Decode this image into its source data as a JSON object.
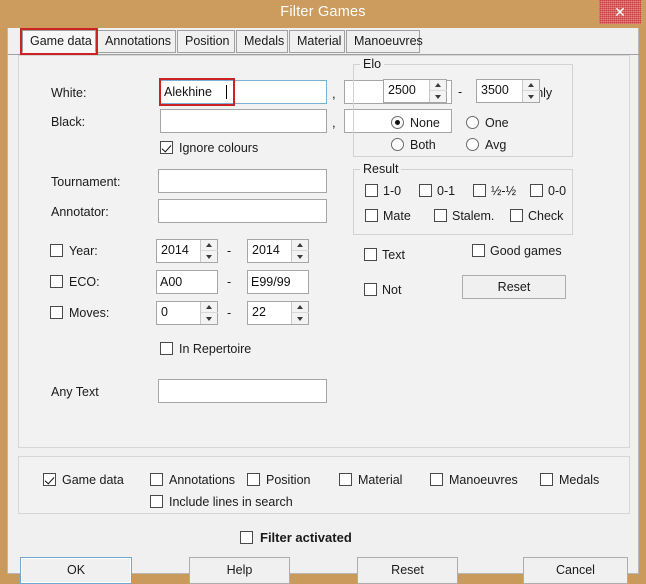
{
  "window": {
    "title": "Filter Games",
    "close_icon": "close-icon",
    "close_label": "✕",
    "titlebar_color": "#cc9b5e",
    "close_color": "#c9413c",
    "annotation_color": "#cc2222"
  },
  "tabs": [
    {
      "label": "Game data",
      "active": true
    },
    {
      "label": "Annotations",
      "active": false
    },
    {
      "label": "Position",
      "active": false
    },
    {
      "label": "Medals",
      "active": false
    },
    {
      "label": "Material",
      "active": false
    },
    {
      "label": "Manoeuvres",
      "active": false
    }
  ],
  "form": {
    "white_label": "White:",
    "white_value": "Alekhine",
    "white_first_value": "",
    "black_label": "Black:",
    "black_value": "",
    "black_first_value": "",
    "comma": ",",
    "ignore_colours_label": "Ignore colours",
    "ignore_colours_checked": true,
    "wins_only_label": "Wins only",
    "wins_only_checked": false,
    "tournament_label": "Tournament:",
    "tournament_value": "",
    "annotator_label": "Annotator:",
    "annotator_value": "",
    "year_label": "Year:",
    "year_checked": false,
    "year_from": "2014",
    "year_to": "2014",
    "eco_label": "ECO:",
    "eco_checked": false,
    "eco_from": "A00",
    "eco_to": "E99/99",
    "moves_label": "Moves:",
    "moves_checked": false,
    "moves_from": "0",
    "moves_to": "22",
    "in_repertoire_label": "In Repertoire",
    "in_repertoire_checked": false,
    "any_text_label": "Any Text",
    "any_text_value": "",
    "range_dash": "-"
  },
  "elo": {
    "title": "Elo",
    "from": "2500",
    "to": "3500",
    "dash": "-",
    "options": [
      {
        "label": "None",
        "selected": true
      },
      {
        "label": "One",
        "selected": false
      },
      {
        "label": "Both",
        "selected": false
      },
      {
        "label": "Avg",
        "selected": false
      }
    ]
  },
  "result": {
    "title": "Result",
    "items": [
      {
        "label": "1-0",
        "checked": false
      },
      {
        "label": "0-1",
        "checked": false
      },
      {
        "label": "½-½",
        "checked": false
      },
      {
        "label": "0-0",
        "checked": false
      },
      {
        "label": "Mate",
        "checked": false
      },
      {
        "label": "Stalem.",
        "checked": false
      },
      {
        "label": "Check",
        "checked": false
      }
    ]
  },
  "misc": {
    "text_label": "Text",
    "text_checked": false,
    "good_games_label": "Good games",
    "good_games_checked": false,
    "not_label": "Not",
    "not_checked": false,
    "reset_label": "Reset"
  },
  "scope": {
    "items": [
      {
        "label": "Game data",
        "checked": true
      },
      {
        "label": "Annotations",
        "checked": false
      },
      {
        "label": "Position",
        "checked": false
      },
      {
        "label": "Material",
        "checked": false
      },
      {
        "label": "Manoeuvres",
        "checked": false
      },
      {
        "label": "Medals",
        "checked": false
      }
    ],
    "include_lines_label": "Include lines in search",
    "include_lines_checked": false
  },
  "filter_activated": {
    "label": "Filter activated",
    "checked": false
  },
  "buttons": {
    "ok": "OK",
    "help": "Help",
    "reset": "Reset",
    "cancel": "Cancel"
  }
}
